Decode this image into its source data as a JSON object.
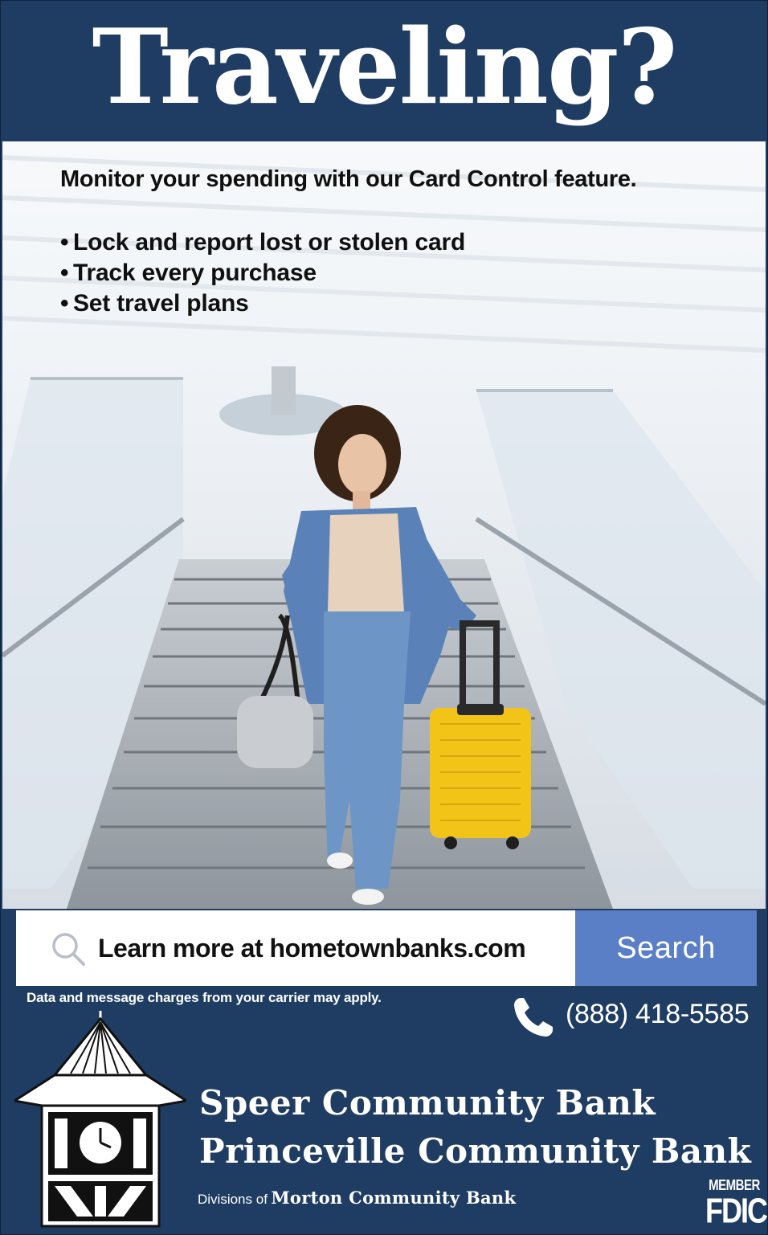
{
  "headline": "Traveling?",
  "intro": "Monitor your spending with our Card Control feature.",
  "bullets": [
    "Lock and report lost or stolen card",
    "Track every purchase",
    "Set travel plans"
  ],
  "search": {
    "text": "Learn more at hometownbanks.com",
    "button_label": "Search",
    "icon": "search-icon"
  },
  "disclaimer": "Data and message charges from your carrier may apply.",
  "phone": {
    "number": "(888) 418-5585",
    "icon": "phone-icon"
  },
  "banks": {
    "line1": "Speer Community Bank",
    "line2": "Princeville Community Bank",
    "divisions_prefix": "Divisions of",
    "parent": "Morton Community Bank",
    "logo_icon": "clock-tower-icon"
  },
  "fdic": {
    "member": "MEMBER",
    "label": "FDIC"
  },
  "colors": {
    "navy": "#1f3d63",
    "button_blue": "#5a7fc7",
    "suitcase_yellow": "#f2c418",
    "denim": "#5a82b8"
  }
}
